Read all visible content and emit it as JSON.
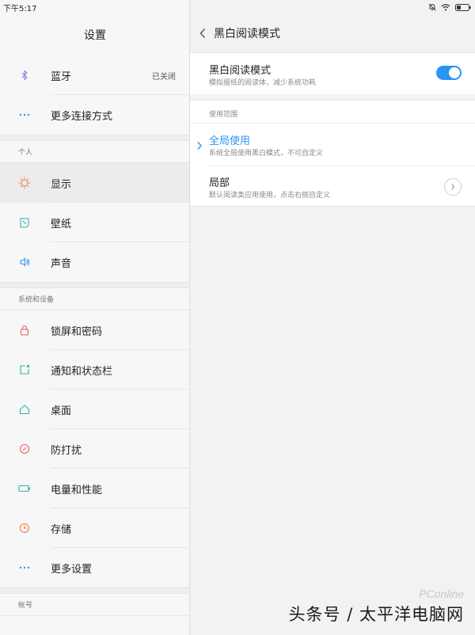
{
  "status_bar": {
    "time": "下午5:17",
    "icons": [
      "mute-icon",
      "wifi-icon",
      "battery-icon"
    ]
  },
  "left": {
    "title": "设置",
    "groups": [
      {
        "items": [
          {
            "label": "蓝牙",
            "value": "已关闭",
            "icon": "bluetooth-icon",
            "color": "#8a7be8"
          },
          {
            "label": "更多连接方式",
            "icon": "more-dots-icon",
            "color": "#2a95f2"
          }
        ]
      },
      {
        "header": "个人",
        "items": [
          {
            "label": "显示",
            "icon": "brightness-icon",
            "color": "#f07b3a",
            "active": true
          },
          {
            "label": "壁纸",
            "icon": "wallpaper-icon",
            "color": "#2fb5a5"
          },
          {
            "label": "声音",
            "icon": "speaker-icon",
            "color": "#2a95f2"
          }
        ]
      },
      {
        "header": "系统和设备",
        "items": [
          {
            "label": "锁屏和密码",
            "icon": "lock-icon",
            "color": "#ee5a64"
          },
          {
            "label": "通知和状态栏",
            "icon": "notification-icon",
            "color": "#2fb5a5"
          },
          {
            "label": "桌面",
            "icon": "home-icon",
            "color": "#2fb5a5"
          },
          {
            "label": "防打扰",
            "icon": "dnd-icon",
            "color": "#ee5a64"
          },
          {
            "label": "电量和性能",
            "icon": "battery-perf-icon",
            "color": "#2fb5a5"
          },
          {
            "label": "存储",
            "icon": "storage-icon",
            "color": "#f07b3a"
          },
          {
            "label": "更多设置",
            "icon": "more-dots-icon",
            "color": "#2a95f2"
          }
        ]
      },
      {
        "header": "帐号"
      }
    ]
  },
  "right": {
    "title": "黑白阅读模式",
    "mode_toggle": {
      "title": "黑白阅读模式",
      "subtitle": "模拟报纸的阅读体，减少系统功耗",
      "on": true
    },
    "scope_label": "使用范围",
    "options": [
      {
        "title": "全局使用",
        "subtitle": "系统全局使用黑白模式，不可自定义",
        "selected": true
      },
      {
        "title": "局部",
        "subtitle": "默认阅读类应用使用，点击右侧自定义",
        "selected": false
      }
    ]
  },
  "watermark": {
    "text": "头条号 / 太平洋电脑网",
    "logo": "PConline"
  },
  "colors": {
    "accent": "#2a95f2",
    "toggle_on": "#2a95f2",
    "active_row": "#ececec"
  }
}
